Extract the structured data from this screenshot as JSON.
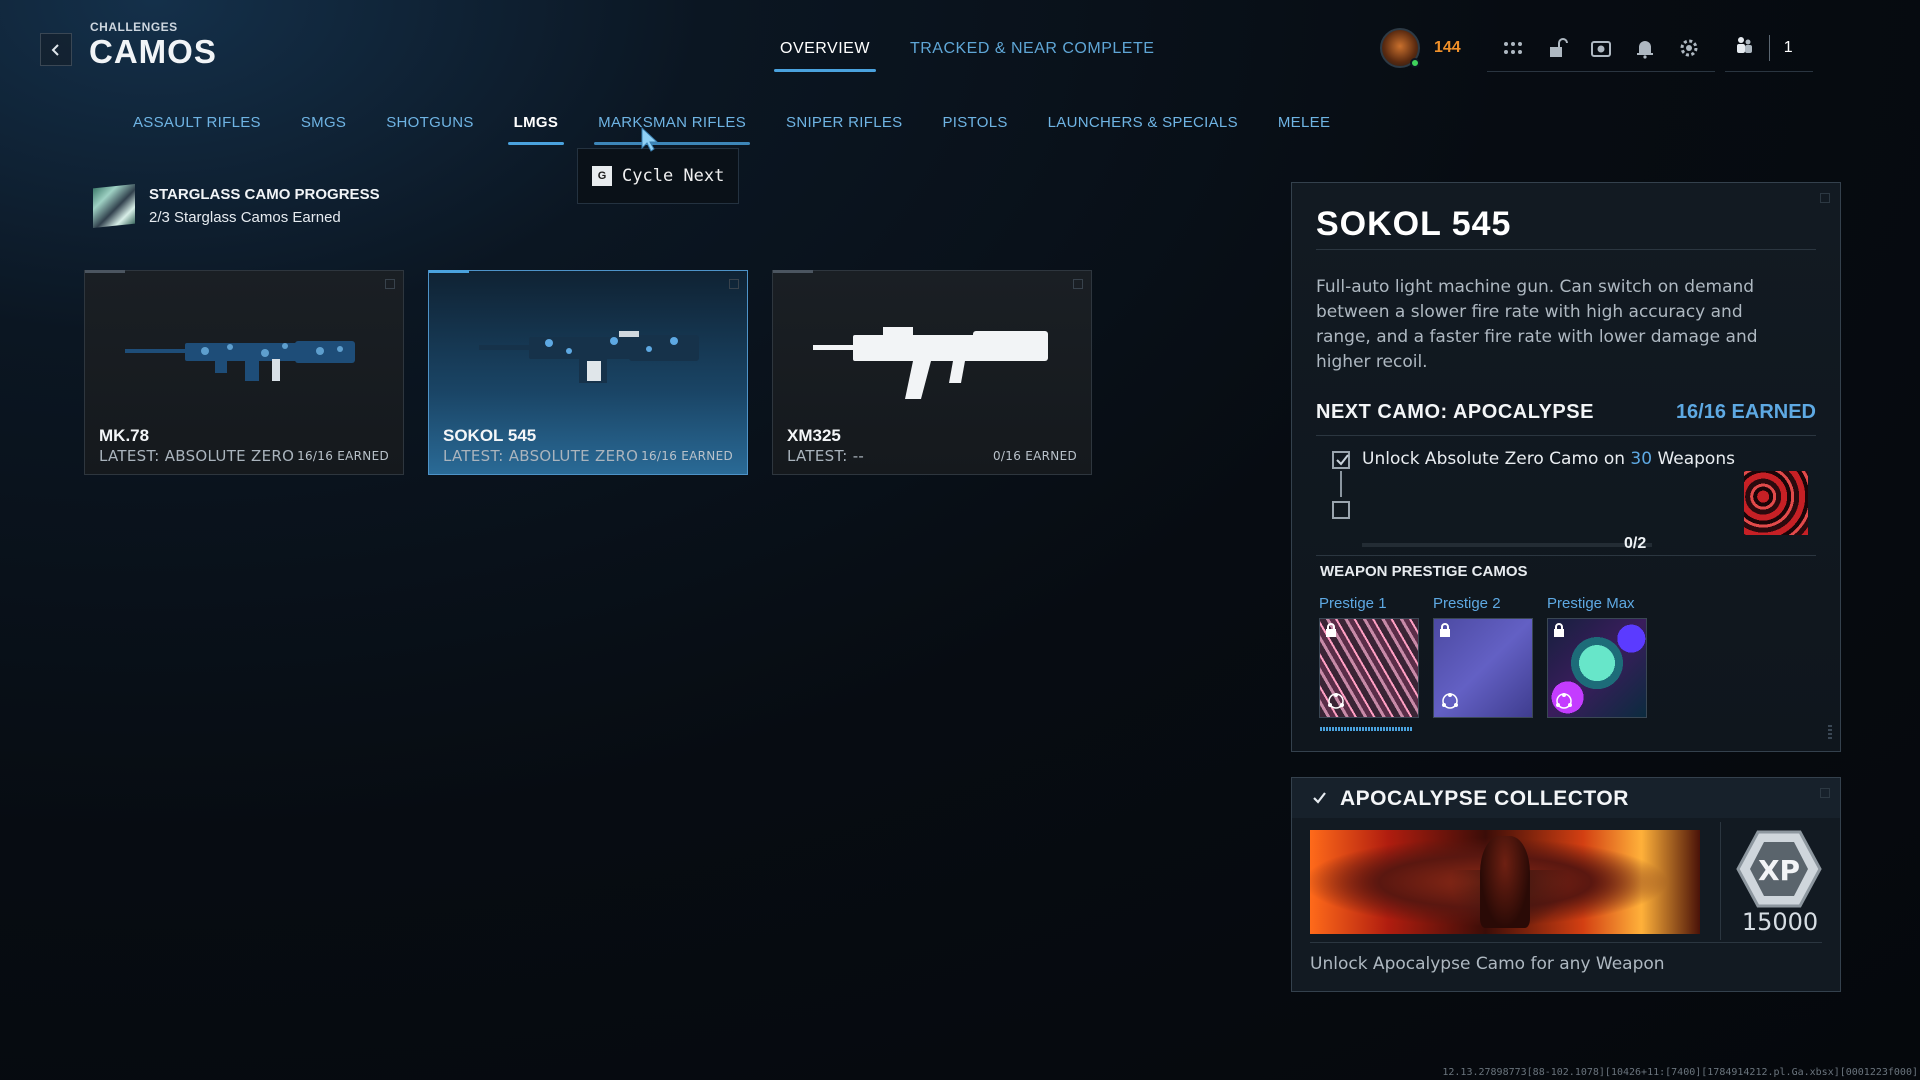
{
  "header": {
    "section": "CHALLENGES",
    "title": "CAMOS",
    "tabs": [
      {
        "label": "OVERVIEW",
        "active": true
      },
      {
        "label": "TRACKED & NEAR COMPLETE",
        "active": false
      }
    ],
    "currency": "144",
    "party_count": "1"
  },
  "categories": [
    {
      "label": "ASSAULT RIFLES"
    },
    {
      "label": "SMGS"
    },
    {
      "label": "SHOTGUNS"
    },
    {
      "label": "LMGS",
      "active": true
    },
    {
      "label": "MARKSMAN RIFLES",
      "hover": true
    },
    {
      "label": "SNIPER RIFLES"
    },
    {
      "label": "PISTOLS"
    },
    {
      "label": "LAUNCHERS & SPECIALS"
    },
    {
      "label": "MELEE"
    }
  ],
  "tooltip": {
    "key": "G",
    "text": "Cycle Next"
  },
  "starglass": {
    "title": "STARGLASS CAMO PROGRESS",
    "subtitle": "2/3 Starglass Camos Earned"
  },
  "weapons": [
    {
      "name": "MK.78",
      "latest": "LATEST: ABSOLUTE ZERO",
      "earned": "16/16 EARNED"
    },
    {
      "name": "SOKOL 545",
      "latest": "LATEST: ABSOLUTE ZERO",
      "earned": "16/16 EARNED"
    },
    {
      "name": "XM325",
      "latest": "LATEST: --",
      "earned": "0/16 EARNED"
    }
  ],
  "detail": {
    "title": "SOKOL 545",
    "description": "Full-auto light machine gun. Can switch on demand between a slower fire rate with high accuracy and range, and a faster fire rate with lower damage and higher recoil.",
    "next_camo": "NEXT CAMO: APOCALYPSE",
    "next_earned": "16/16 EARNED",
    "requirement_pre": "Unlock Absolute Zero Camo on ",
    "requirement_num": "30",
    "requirement_post": " Weapons",
    "progress": "0/2",
    "prestige_title": "WEAPON PRESTIGE CAMOS",
    "prestige": [
      {
        "label": "Prestige 1"
      },
      {
        "label": "Prestige 2"
      },
      {
        "label": "Prestige Max"
      }
    ]
  },
  "collector": {
    "title": "APOCALYPSE COLLECTOR",
    "xp_badge": "XP",
    "xp_value": "15000",
    "description": "Unlock Apocalypse Camo for any Weapon"
  },
  "build_string": "12.13.27898773[88-102.1078][10426+11:[7400][1784914212.pl.Ga.xbsx][0001223f000]",
  "colors": {
    "accent": "#4aa2de",
    "link": "#5ea9e3",
    "currency": "#f0902a"
  }
}
